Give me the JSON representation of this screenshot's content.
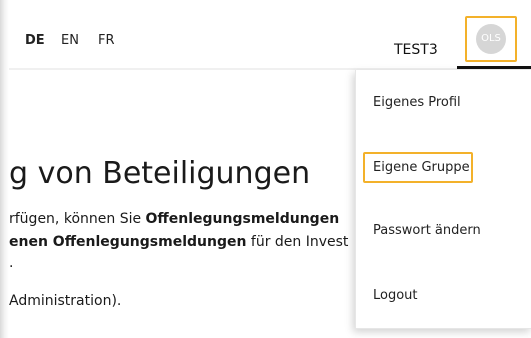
{
  "languages": {
    "de": "DE",
    "en": "EN",
    "fr": "FR"
  },
  "user": {
    "name": "TEST3",
    "avatar_initials": "OLS"
  },
  "content": {
    "heading": "g von Beteiligungen",
    "line1_prefix": "rfügen, können Sie ",
    "line1_bold": "Offenlegungsmeldungen",
    "line2_bold": "enen Offenlegungsmeldungen",
    "line2_suffix": " für den Invest",
    "line3": ".",
    "line4": "Administration)."
  },
  "user_menu": {
    "items": [
      {
        "label": "Eigenes Profil"
      },
      {
        "label": "Eigene Gruppe"
      },
      {
        "label": "Passwort ändern"
      },
      {
        "label": "Logout"
      }
    ]
  },
  "colors": {
    "highlight": "#f3b12a",
    "avatar_bg": "#d6d6d6",
    "underline": "#111111"
  }
}
